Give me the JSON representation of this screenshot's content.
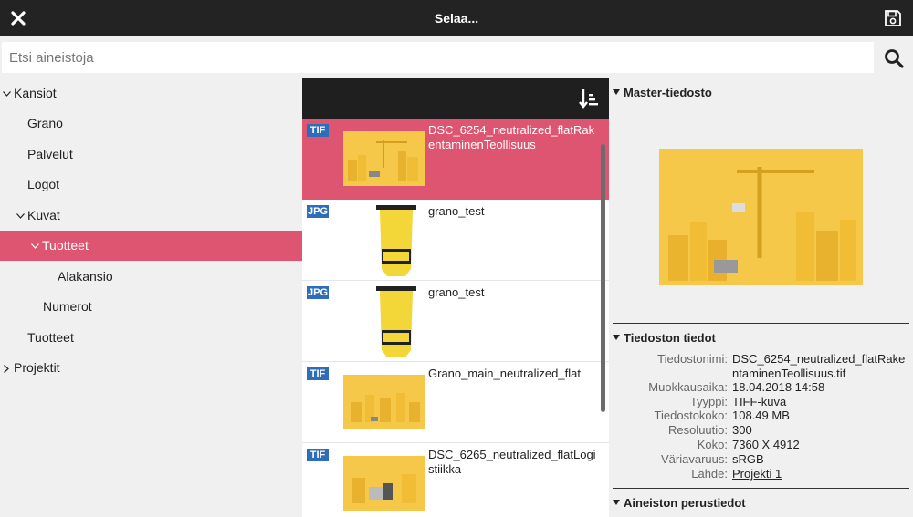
{
  "topbar": {
    "title": "Selaa...",
    "close_icon": "close-icon",
    "save_icon": "save-icon"
  },
  "search": {
    "placeholder": "Etsi aineistoja",
    "value": "",
    "icon": "search-icon"
  },
  "tree": {
    "items": [
      {
        "label": "Kansiot",
        "expanded": true
      },
      {
        "label": "Grano"
      },
      {
        "label": "Palvelut"
      },
      {
        "label": "Logot"
      },
      {
        "label": "Kuvat",
        "expanded": true
      },
      {
        "label": "Tuotteet",
        "expanded": true,
        "selected": true
      },
      {
        "label": "Alakansio"
      },
      {
        "label": "Numerot"
      },
      {
        "label": "Tuotteet"
      },
      {
        "label": "Projektit",
        "expanded": false
      }
    ]
  },
  "list": {
    "sort_icon": "sort-icon",
    "items": [
      {
        "badge": "TIF",
        "name": "DSC_6254_neutralized_flatRakentaminenTeollisuus",
        "selected": true,
        "thumb": "crane"
      },
      {
        "badge": "JPG",
        "name": "grano_test",
        "thumb": "sign"
      },
      {
        "badge": "JPG",
        "name": "grano_test",
        "thumb": "sign"
      },
      {
        "badge": "TIF",
        "name": "Grano_main_neutralized_flat",
        "thumb": "city"
      },
      {
        "badge": "TIF",
        "name": "DSC_6265_neutralized_flatLogistiikka",
        "thumb": "truck"
      }
    ]
  },
  "detail": {
    "master_title": "Master-tiedosto",
    "info_title": "Tiedoston tiedot",
    "basic_title": "Aineiston perustiedot",
    "fields": [
      {
        "key": "Tiedostonimi:",
        "value": "DSC_6254_neutralized_flatRakentaminenTeollisuus.tif"
      },
      {
        "key": "Muokkausaika:",
        "value": "18.04.2018 14:58"
      },
      {
        "key": "Tyyppi:",
        "value": "TIFF-kuva"
      },
      {
        "key": "Tiedostokoko:",
        "value": "108.49 MB"
      },
      {
        "key": "Resoluutio:",
        "value": "300"
      },
      {
        "key": "Koko:",
        "value": "7360 X 4912"
      },
      {
        "key": "Väriavaruus:",
        "value": "sRGB"
      },
      {
        "key": "Lähde:",
        "value": "Projekti 1"
      }
    ]
  },
  "colors": {
    "topbar": "#232323",
    "selected": "#dd5570",
    "badge": "#2e6db8",
    "thumb_bg": "#f5c84a"
  }
}
